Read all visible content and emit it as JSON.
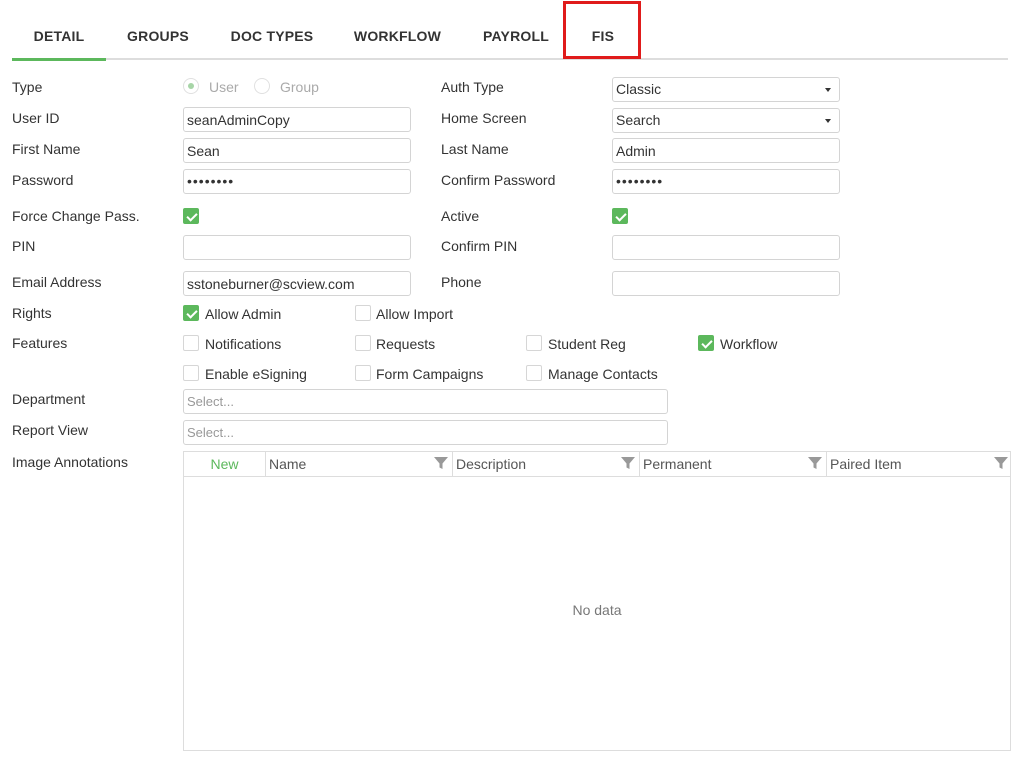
{
  "tabs": [
    {
      "label": "DETAIL"
    },
    {
      "label": "GROUPS"
    },
    {
      "label": "DOC TYPES"
    },
    {
      "label": "WORKFLOW"
    },
    {
      "label": "PAYROLL"
    },
    {
      "label": "FIS"
    }
  ],
  "form": {
    "type_label": "Type",
    "type_options": {
      "user": "User",
      "group": "Group",
      "selected": "User"
    },
    "auth_type_label": "Auth Type",
    "auth_type_value": "Classic",
    "user_id_label": "User ID",
    "user_id_value": "seanAdminCopy",
    "home_screen_label": "Home Screen",
    "home_screen_value": "Search",
    "first_name_label": "First Name",
    "first_name_value": "Sean",
    "last_name_label": "Last Name",
    "last_name_value": "Admin",
    "password_label": "Password",
    "password_value": "••••••••",
    "confirm_password_label": "Confirm Password",
    "confirm_password_value": "••••••••",
    "force_change_label": "Force Change Pass.",
    "force_change_checked": true,
    "active_label": "Active",
    "active_checked": true,
    "pin_label": "PIN",
    "pin_value": "",
    "confirm_pin_label": "Confirm PIN",
    "confirm_pin_value": "",
    "email_label": "Email Address",
    "email_value": "sstoneburner@scview.com",
    "phone_label": "Phone",
    "phone_value": "",
    "rights_label": "Rights",
    "rights": [
      {
        "label": "Allow Admin",
        "checked": true
      },
      {
        "label": "Allow Import",
        "checked": false
      }
    ],
    "features_label": "Features",
    "features": [
      {
        "label": "Notifications",
        "checked": false
      },
      {
        "label": "Requests",
        "checked": false
      },
      {
        "label": "Student Reg",
        "checked": false
      },
      {
        "label": "Workflow",
        "checked": true
      },
      {
        "label": "Enable eSigning",
        "checked": false
      },
      {
        "label": "Form Campaigns",
        "checked": false
      },
      {
        "label": "Manage Contacts",
        "checked": false
      }
    ],
    "department_label": "Department",
    "department_placeholder": "Select...",
    "report_view_label": "Report View",
    "report_view_placeholder": "Select...",
    "image_annotations_label": "Image Annotations"
  },
  "grid": {
    "new_label": "New",
    "columns": [
      "Name",
      "Description",
      "Permanent",
      "Paired Item"
    ],
    "empty_text": "No data"
  },
  "colors": {
    "accent": "#5cb85c",
    "highlight": "#e01b1b"
  }
}
